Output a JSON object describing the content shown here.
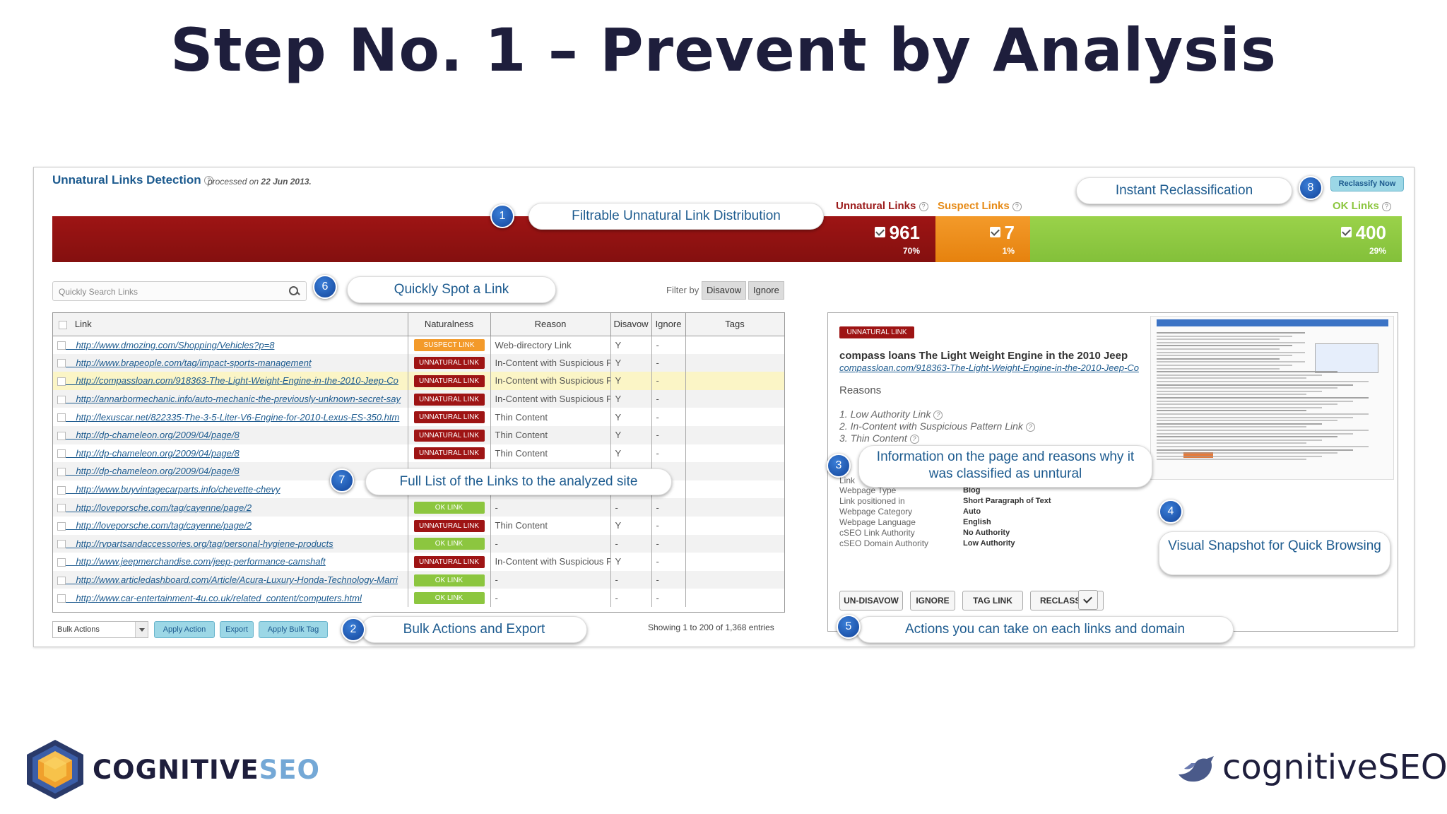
{
  "slide_title": "Step No. 1 – Prevent by Analysis",
  "app": {
    "title": "Unnatural Links Detection",
    "processed_prefix": "processed on ",
    "processed_date": "22 Jun 2013.",
    "reclassify_now": "Reclassify Now"
  },
  "distribution": {
    "unnatural_label": "Unnatural Links",
    "suspect_label": "Suspect Links",
    "ok_label": "OK Links",
    "unnatural_count": "961",
    "unnatural_pct": "70%",
    "suspect_count": "7",
    "suspect_pct": "1%",
    "ok_count": "400",
    "ok_pct": "29%",
    "colors": {
      "unnatural": "#9e1414",
      "suspect": "#f39a2a",
      "ok": "#8cc63f"
    }
  },
  "search": {
    "placeholder": "Quickly Search Links",
    "icon": "search-icon"
  },
  "filter": {
    "label": "Filter by",
    "disavow": "Disavow",
    "ignore": "Ignore"
  },
  "table": {
    "columns": [
      "Link",
      "Naturalness",
      "Reason",
      "Disavow",
      "Ignore",
      "Tags"
    ],
    "rows": [
      {
        "url": "http://www.dmozing.com/Shopping/Vehicles?p=8",
        "badge": "SUSPECT LINK",
        "type": "suspect",
        "reason": "Web-directory Link",
        "disavow": "Y",
        "ignore": "-"
      },
      {
        "url": "http://www.brapeople.com/tag/impact-sports-management",
        "badge": "UNNATURAL LINK",
        "type": "unnatural",
        "reason": "In-Content with Suspicious P",
        "disavow": "Y",
        "ignore": "-"
      },
      {
        "url": "http://compassloan.com/918363-The-Light-Weight-Engine-in-the-2010-Jeep-Co",
        "badge": "UNNATURAL LINK",
        "type": "unnatural",
        "reason": "In-Content with Suspicious P",
        "disavow": "Y",
        "ignore": "-"
      },
      {
        "url": "http://annarbormechanic.info/auto-mechanic-the-previously-unknown-secret-say",
        "badge": "UNNATURAL LINK",
        "type": "unnatural",
        "reason": "In-Content with Suspicious P",
        "disavow": "Y",
        "ignore": "-"
      },
      {
        "url": "http://lexuscar.net/822335-The-3-5-Liter-V6-Engine-for-2010-Lexus-ES-350.htm",
        "badge": "UNNATURAL LINK",
        "type": "unnatural",
        "reason": "Thin Content",
        "disavow": "Y",
        "ignore": "-"
      },
      {
        "url": "http://dp-chameleon.org/2009/04/page/8",
        "badge": "UNNATURAL LINK",
        "type": "unnatural",
        "reason": "Thin Content",
        "disavow": "Y",
        "ignore": "-"
      },
      {
        "url": "http://dp-chameleon.org/2009/04/page/8",
        "badge": "UNNATURAL LINK",
        "type": "unnatural",
        "reason": "Thin Content",
        "disavow": "Y",
        "ignore": "-"
      },
      {
        "url": "http://dp-chameleon.org/2009/04/page/8",
        "badge": "",
        "type": "none",
        "reason": "",
        "disavow": "",
        "ignore": ""
      },
      {
        "url": "http://www.buyvintagecarparts.info/chevette-chevy",
        "badge": "",
        "type": "none",
        "reason": "",
        "disavow": "",
        "ignore": ""
      },
      {
        "url": "http://loveporsche.com/tag/cayenne/page/2",
        "badge": "OK LINK",
        "type": "ok",
        "reason": "-",
        "disavow": "-",
        "ignore": "-"
      },
      {
        "url": "http://loveporsche.com/tag/cayenne/page/2",
        "badge": "UNNATURAL LINK",
        "type": "unnatural",
        "reason": "Thin Content",
        "disavow": "Y",
        "ignore": "-"
      },
      {
        "url": "http://rvpartsandaccessories.org/tag/personal-hygiene-products",
        "badge": "OK LINK",
        "type": "ok",
        "reason": "-",
        "disavow": "-",
        "ignore": "-"
      },
      {
        "url": "http://www.jeepmerchandise.com/jeep-performance-camshaft",
        "badge": "UNNATURAL LINK",
        "type": "unnatural",
        "reason": "In-Content with Suspicious P",
        "disavow": "Y",
        "ignore": "-"
      },
      {
        "url": "http://www.articledashboard.com/Article/Acura-Luxury-Honda-Technology-Marri",
        "badge": "OK LINK",
        "type": "ok",
        "reason": "-",
        "disavow": "-",
        "ignore": "-"
      },
      {
        "url": "http://www.car-entertainment-4u.co.uk/related_content/computers.html",
        "badge": "OK LINK",
        "type": "ok",
        "reason": "-",
        "disavow": "-",
        "ignore": "-"
      }
    ]
  },
  "bulk": {
    "select_value": "Bulk Actions",
    "apply_action": "Apply Action",
    "export": "Export",
    "apply_bulk_tag": "Apply Bulk Tag",
    "showing": "Showing 1 to 200 of 1,368 entries"
  },
  "detail": {
    "badge": "UNNATURAL LINK",
    "title": "compass loans The Light Weight Engine in the 2010 Jeep",
    "url": "compassloan.com/918363-The-Light-Weight-Engine-in-the-2010-Jeep-Co",
    "reasons_heading": "Reasons",
    "reasons": [
      "1.  Low Authority Link",
      "2.  In-Content with Suspicious Pattern Link",
      "3.  Thin Content"
    ],
    "properties": [
      {
        "label": "Link",
        "value": ""
      },
      {
        "label": "Webpage Type",
        "value": "Blog"
      },
      {
        "label": "Link positioned in",
        "value": "Short Paragraph of Text"
      },
      {
        "label": "Webpage Category",
        "value": "Auto"
      },
      {
        "label": "Webpage Language",
        "value": "English"
      },
      {
        "label": "cSEO Link Authority",
        "value": "No Authority"
      },
      {
        "label": "cSEO Domain Authority",
        "value": "Low Authority"
      }
    ],
    "actions": {
      "undisavow": "UN-DISAVOW",
      "ignore": "IGNORE",
      "tag_link": "TAG LINK",
      "reclassify": "RECLASSIFY"
    }
  },
  "callouts": [
    {
      "num": "1",
      "text": "Filtrable Unnatural Link Distribution"
    },
    {
      "num": "2",
      "text": "Bulk Actions and Export"
    },
    {
      "num": "3",
      "text_line1": "Information on the page and reasons why it",
      "text_line2": "was classified as unntural"
    },
    {
      "num": "4",
      "text": "Visual Snapshot for Quick Browsing"
    },
    {
      "num": "5",
      "text": "Actions you can take on each links and domain"
    },
    {
      "num": "6",
      "text": "Quickly Spot a Link"
    },
    {
      "num": "7",
      "text": "Full List of the Links to the analyzed site"
    },
    {
      "num": "8",
      "text": "Instant Reclassification"
    }
  ],
  "branding": {
    "left_brand": "COGNITIVE",
    "left_brand_accent": "SEO",
    "right_brand": "cognitiveSEO"
  }
}
